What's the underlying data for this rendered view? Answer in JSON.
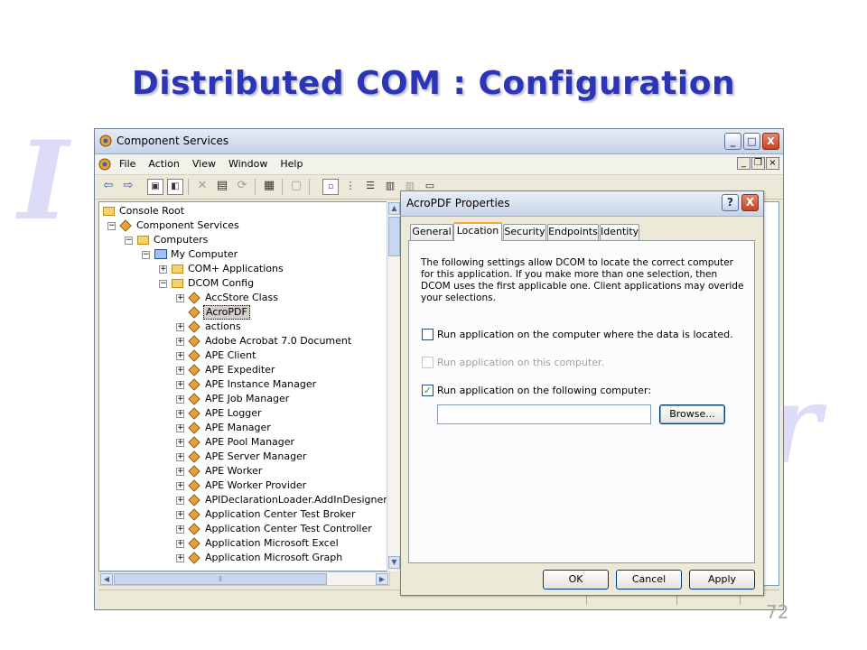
{
  "slide": {
    "title": "Distributed COM : Configuration",
    "page_number": "72"
  },
  "window": {
    "title": "Component Services",
    "controls": {
      "minimize": "_",
      "maximize": "□",
      "close": "X"
    },
    "menu": [
      "File",
      "Action",
      "View",
      "Window",
      "Help"
    ],
    "mdi_controls": {
      "minimize": "_",
      "restore": "❐",
      "close": "×"
    }
  },
  "tree": {
    "nodes": [
      {
        "label": "Console Root",
        "level": 0,
        "expander": "",
        "icon": "folder-icon"
      },
      {
        "label": "Component Services",
        "level": 1,
        "expander": "−",
        "icon": "component-services-icon"
      },
      {
        "label": "Computers",
        "level": 2,
        "expander": "−",
        "icon": "folder-icon"
      },
      {
        "label": "My Computer",
        "level": 3,
        "expander": "−",
        "icon": "my-computer-icon"
      },
      {
        "label": "COM+ Applications",
        "level": 4,
        "expander": "+",
        "icon": "folder-icon"
      },
      {
        "label": "DCOM Config",
        "level": 4,
        "expander": "−",
        "icon": "folder-icon"
      },
      {
        "label": "AccStore Class",
        "level": 5,
        "expander": "+",
        "icon": "component-icon"
      },
      {
        "label": "AcroPDF",
        "level": 5,
        "expander": "",
        "icon": "component-icon",
        "selected": true
      },
      {
        "label": "actions",
        "level": 5,
        "expander": "+",
        "icon": "component-icon"
      },
      {
        "label": "Adobe Acrobat 7.0 Document",
        "level": 5,
        "expander": "+",
        "icon": "component-icon"
      },
      {
        "label": "APE Client",
        "level": 5,
        "expander": "+",
        "icon": "component-icon"
      },
      {
        "label": "APE Expediter",
        "level": 5,
        "expander": "+",
        "icon": "component-icon"
      },
      {
        "label": "APE Instance Manager",
        "level": 5,
        "expander": "+",
        "icon": "component-icon"
      },
      {
        "label": "APE Job Manager",
        "level": 5,
        "expander": "+",
        "icon": "component-icon"
      },
      {
        "label": "APE Logger",
        "level": 5,
        "expander": "+",
        "icon": "component-icon"
      },
      {
        "label": "APE Manager",
        "level": 5,
        "expander": "+",
        "icon": "component-icon"
      },
      {
        "label": "APE Pool Manager",
        "level": 5,
        "expander": "+",
        "icon": "component-icon"
      },
      {
        "label": "APE Server Manager",
        "level": 5,
        "expander": "+",
        "icon": "component-icon"
      },
      {
        "label": "APE Worker",
        "level": 5,
        "expander": "+",
        "icon": "component-icon"
      },
      {
        "label": "APE Worker Provider",
        "level": 5,
        "expander": "+",
        "icon": "component-icon"
      },
      {
        "label": "APIDeclarationLoader.AddInDesigner",
        "level": 5,
        "expander": "+",
        "icon": "component-icon"
      },
      {
        "label": "Application Center Test Broker",
        "level": 5,
        "expander": "+",
        "icon": "component-icon"
      },
      {
        "label": "Application Center Test Controller",
        "level": 5,
        "expander": "+",
        "icon": "component-icon"
      },
      {
        "label": "Application Microsoft Excel",
        "level": 5,
        "expander": "+",
        "icon": "component-icon"
      },
      {
        "label": "Application Microsoft Graph",
        "level": 5,
        "expander": "+",
        "icon": "component-icon"
      }
    ]
  },
  "dialog": {
    "title": "AcroPDF Properties",
    "help_button": "?",
    "close_button": "X",
    "tabs": [
      "General",
      "Location",
      "Security",
      "Endpoints",
      "Identity"
    ],
    "active_tab": "Location",
    "description": "The following settings allow DCOM to locate the correct computer for this application. If you make more than one selection, then DCOM uses the first applicable one. Client applications may overide your selections.",
    "options": [
      {
        "label": "Run application on the computer where the data is located.",
        "checked": false,
        "enabled": true
      },
      {
        "label": "Run application on this computer.",
        "checked": false,
        "enabled": false
      },
      {
        "label": "Run application on the following computer:",
        "checked": true,
        "enabled": true
      }
    ],
    "computer_value": "",
    "browse_label": "Browse...",
    "ok_label": "OK",
    "cancel_label": "Cancel",
    "apply_label": "Apply"
  },
  "colors": {
    "title_blue": "#2b35b5",
    "watermark": "#dcdcf6",
    "active_tab_accent": "#f2a837",
    "check_green": "#21a121"
  }
}
